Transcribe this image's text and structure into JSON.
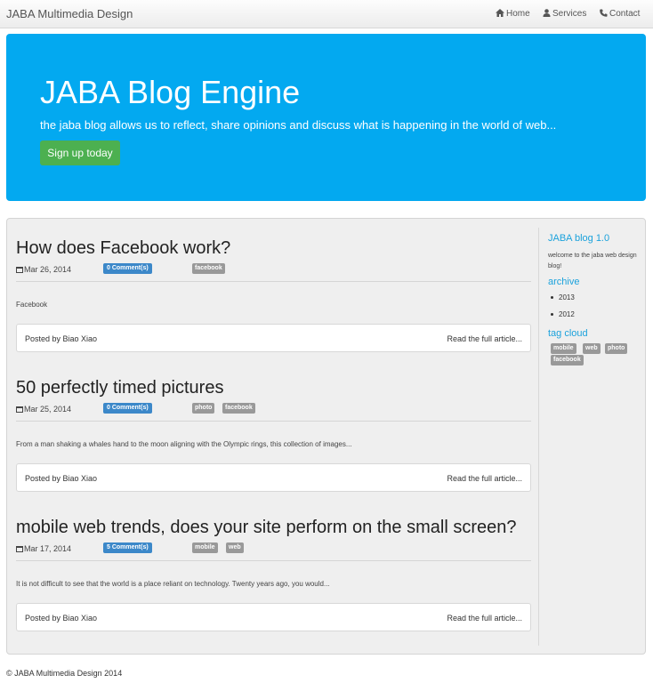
{
  "navbar": {
    "brand": "JABA Multimedia Design",
    "links": [
      {
        "label": "Home",
        "icon": "home-icon"
      },
      {
        "label": "Services",
        "icon": "user-icon"
      },
      {
        "label": "Contact",
        "icon": "phone-icon"
      }
    ]
  },
  "jumbotron": {
    "title": "JABA Blog Engine",
    "subtitle": "the jaba blog allows us to reflect, share opinions and discuss what is happening in the world of web...",
    "button": "Sign up today",
    "bg_color": "#03a9f0",
    "button_color": "#4cb050"
  },
  "posts": [
    {
      "title": "How does Facebook work?",
      "date": "Mar 26, 2014",
      "comments": "0 Comment(s)",
      "tags": [
        "facebook"
      ],
      "excerpt": "Facebook",
      "author": "Posted by Biao Xiao",
      "read_more": "Read the full article..."
    },
    {
      "title": "50 perfectly timed pictures",
      "date": "Mar 25, 2014",
      "comments": "0 Comment(s)",
      "tags": [
        "photo",
        "facebook"
      ],
      "excerpt": "From a man shaking a whales hand to the moon aligning with the Olympic rings, this collection of images...",
      "author": "Posted by Biao Xiao",
      "read_more": "Read the full article..."
    },
    {
      "title": "mobile web trends, does your site perform on the small screen?",
      "date": "Mar 17, 2014",
      "comments": "5 Comment(s)",
      "tags": [
        "mobile",
        "web"
      ],
      "excerpt": "It is not difficult to see that the world is a place reliant on technology. Twenty years ago, you would...",
      "author": "Posted by Biao Xiao",
      "read_more": "Read the full article..."
    }
  ],
  "sidebar": {
    "about_heading": "JABA blog 1.0",
    "about_text": "welcome to the jaba web design blog!",
    "archive_heading": "archive",
    "archive_items": [
      "2013",
      "2012"
    ],
    "tagcloud_heading": "tag cloud",
    "tags": [
      "mobile",
      "web",
      "photo",
      "facebook"
    ]
  },
  "footer": {
    "text": "© JABA Multimedia Design 2014"
  }
}
